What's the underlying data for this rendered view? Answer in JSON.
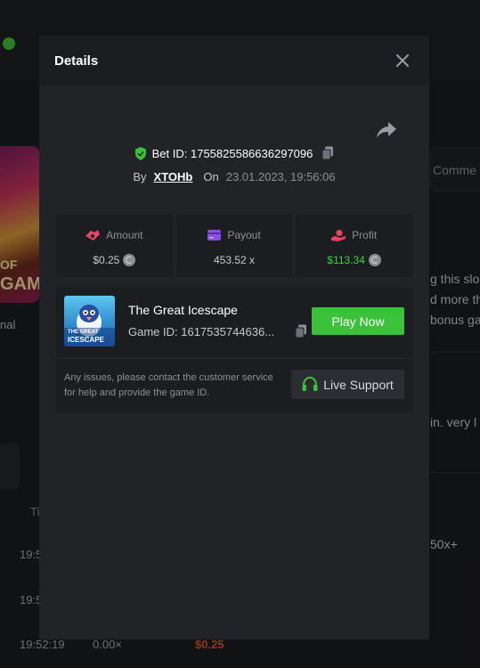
{
  "background": {
    "left_thumb_text_line1": "OF",
    "left_thumb_text_line2": "GAM",
    "left_label": "nal",
    "left_header": "Ti",
    "left_rows": [
      "19:5",
      "19:5"
    ],
    "bottom_row": {
      "time": "19:52:19",
      "payout": "0.00×",
      "profit": "$0.25"
    },
    "right_tab": "Comme",
    "right_lines": [
      "g this slo",
      "d more th",
      "bonus ga"
    ],
    "right_comment": "in. very l",
    "right_multiplier": "50x+"
  },
  "modal": {
    "title": "Details",
    "bet_id_label": "Bet ID: 1755825586636297096",
    "by_label": "By",
    "username": "XTOHb",
    "on_label": "On",
    "date": "23.01.2023, 19:56:06",
    "stats": [
      {
        "label": "Amount",
        "value": "$0.25",
        "icon": "amount-icon",
        "color": "#e8456b"
      },
      {
        "label": "Payout",
        "value": "453.52 x",
        "icon": "payout-card-icon",
        "color": "#8a4fe0"
      },
      {
        "label": "Profit",
        "value": "$113.34",
        "icon": "profit-icon",
        "color": "#e8455a"
      }
    ],
    "game": {
      "name": "The Great Icescape",
      "id_label": "Game ID: 1617535744636...",
      "thumb_text_line1": "THE GREAT",
      "thumb_text_line2": "ICESCAPE",
      "play_label": "Play Now"
    },
    "support_text": "Any issues, please contact the customer service for help and provide the game ID.",
    "support_button_label": "Live Support"
  },
  "colors": {
    "accent_green": "#3cc23a",
    "profit_green": "#3fd23a"
  }
}
